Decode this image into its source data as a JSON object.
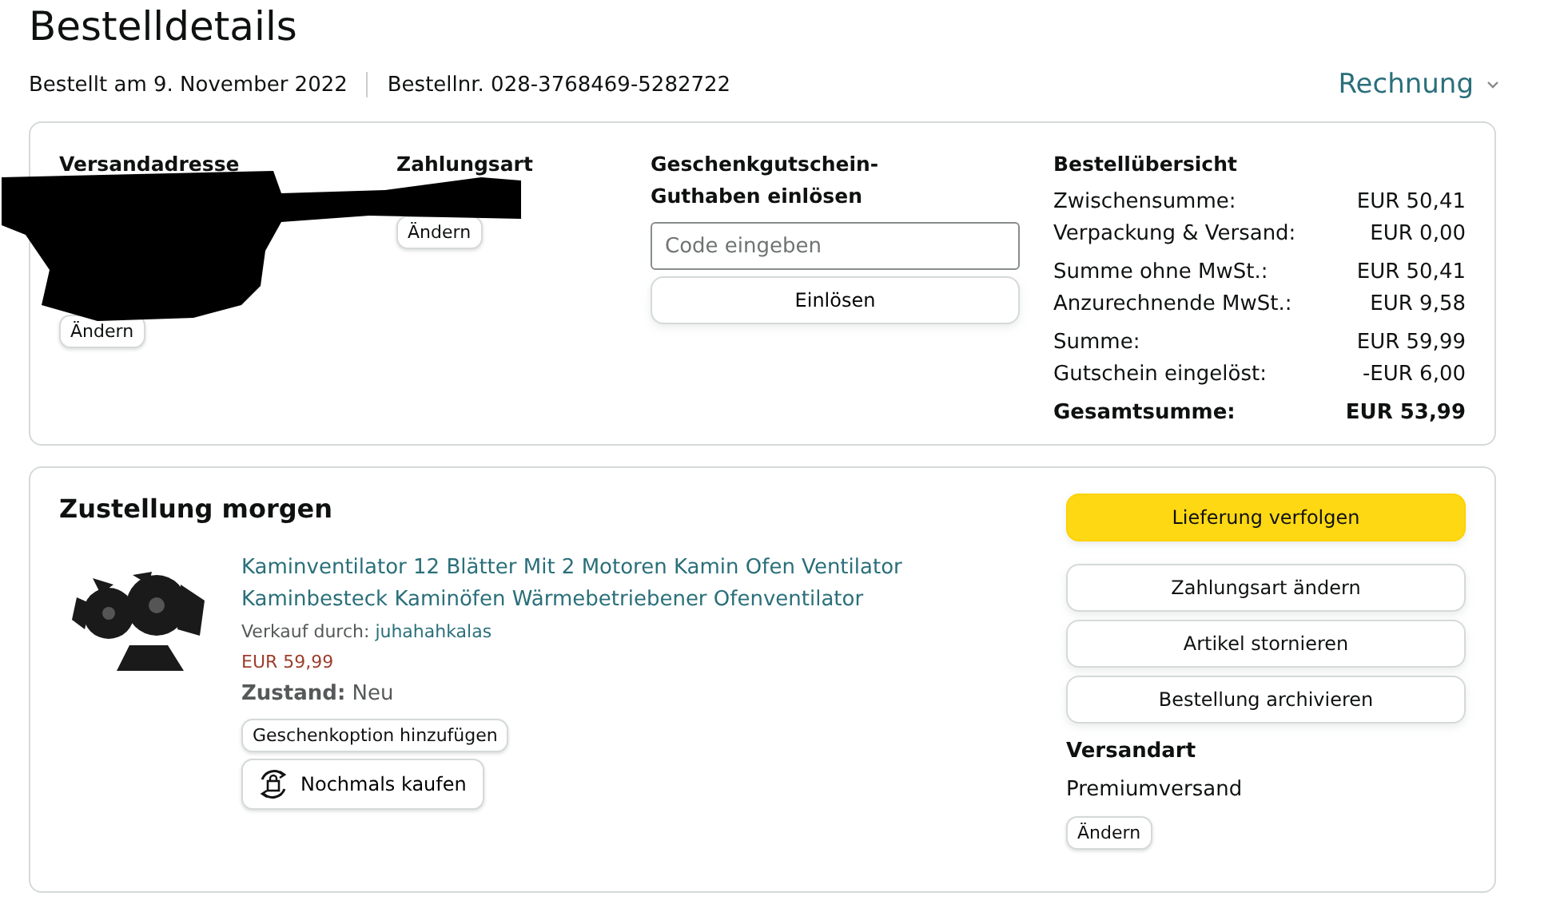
{
  "page_title": "Bestelldetails",
  "order_info": {
    "date": "Bestellt am 9. November 2022",
    "order_number": "Bestellnr. 028-3768469-5282722",
    "invoice_link": "Rechnung"
  },
  "summary_card": {
    "redacted": true,
    "shipping_address": {
      "heading": "Versandadresse",
      "button": "Ändern"
    },
    "payment": {
      "heading": "Zahlungsart",
      "button": "Ändern"
    },
    "gift_card": {
      "heading": "Geschenkgutschein-Guthaben einlösen",
      "placeholder": "Code eingeben",
      "button": "Einlösen"
    },
    "order_summary": {
      "heading": "Bestellübersicht",
      "groups": [
        [
          {
            "label": "Zwischensumme:",
            "value": "EUR 50,41",
            "bold": false
          },
          {
            "label": "Verpackung & Versand:",
            "value": "EUR 0,00",
            "bold": false
          }
        ],
        [
          {
            "label": "Summe ohne MwSt.:",
            "value": "EUR 50,41",
            "bold": false
          },
          {
            "label": "Anzurechnende MwSt.:",
            "value": "EUR 9,58",
            "bold": false
          }
        ],
        [
          {
            "label": "Summe:",
            "value": "EUR 59,99",
            "bold": false
          },
          {
            "label": "Gutschein eingelöst:",
            "value": "-EUR 6,00",
            "bold": false
          }
        ],
        [
          {
            "label": "Gesamtsumme:",
            "value": "EUR 53,99",
            "bold": true
          }
        ]
      ]
    }
  },
  "shipment_card": {
    "heading": "Zustellung morgen",
    "item": {
      "title": "Kaminventilator 12 Blätter Mit 2 Motoren Kamin Ofen Ventilator Kaminbesteck Kaminöfen Wärmebetriebener Ofenventilator",
      "seller_label": "Verkauf durch:",
      "seller": "juhahahkalas",
      "price": "EUR 59,99",
      "condition": "**Zustand:** Neu",
      "gift_button": "Geschenkoption hinzufügen",
      "buy_again_button": "Nochmals kaufen"
    },
    "actions": [
      {
        "label": "Lieferung verfolgen",
        "kind": "primary"
      },
      {
        "label": "Zahlungsart ändern",
        "kind": "secondary"
      },
      {
        "label": "Artikel stornieren",
        "kind": "secondary"
      },
      {
        "label": "Bestellung archivieren",
        "kind": "secondary"
      }
    ],
    "shipping_method": {
      "heading": "Versandart",
      "value": "Premiumversand",
      "button": "Ändern"
    }
  }
}
